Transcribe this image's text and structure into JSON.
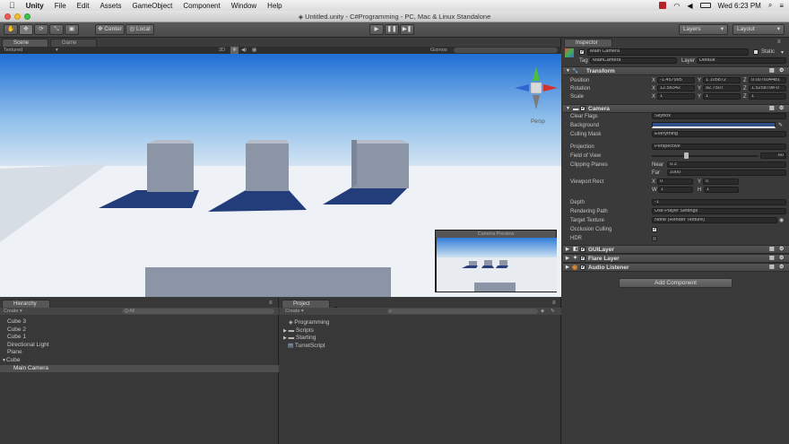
{
  "macmenu": {
    "apple": "",
    "items": [
      "Unity",
      "File",
      "Edit",
      "Assets",
      "GameObject",
      "Component",
      "Window",
      "Help"
    ],
    "clock": "Wed 6:23 PM"
  },
  "window": {
    "title": "Untitled.unity - C#Programming - PC, Mac & Linux Standalone"
  },
  "toolbar": {
    "center": "Center",
    "local": "Local",
    "layers": "Layers",
    "layout": "Layout"
  },
  "scene": {
    "tab_scene": "Scene",
    "tab_game": "Game",
    "shading": "Textured",
    "twod": "2D",
    "gizmos": "Gizmos",
    "persp": "Persp",
    "camera_preview": "Camera Preview"
  },
  "hierarchy": {
    "tab": "Hierarchy",
    "create": "Create",
    "search_placeholder": "Q-All",
    "items": [
      "Cube 3",
      "Cube 2",
      "Cube 1",
      "Directional Light",
      "Plane",
      "Cube",
      "Main Camera"
    ]
  },
  "project": {
    "tab": "Project",
    "create": "Create",
    "root": "Programming",
    "items": [
      "Scripts",
      "Starting",
      "TurretScript"
    ]
  },
  "inspector": {
    "tab": "Inspector",
    "object_name": "Main Camera",
    "static_label": "Static",
    "tag_label": "Tag",
    "tag_value": "MainCamera",
    "layer_label": "Layer",
    "layer_value": "Default",
    "transform": {
      "title": "Transform",
      "position_label": "Position",
      "rotation_label": "Rotation",
      "scale_label": "Scale",
      "position": [
        "-1.457995",
        "1.105872",
        "0.007694481"
      ],
      "rotation": [
        "12.58342",
        "92.7507",
        "1.525879e-0"
      ],
      "scale": [
        "1",
        "1",
        "1"
      ]
    },
    "camera": {
      "title": "Camera",
      "clear_flags_label": "Clear Flags",
      "clear_flags": "Skybox",
      "background_label": "Background",
      "culling_mask_label": "Culling Mask",
      "culling_mask": "Everything",
      "projection_label": "Projection",
      "projection": "Perspective",
      "fov_label": "Field of View",
      "fov": "60",
      "clipping_label": "Clipping Planes",
      "near_label": "Near",
      "near": "0.3",
      "far_label": "Far",
      "far": "1000",
      "viewport_label": "Viewport Rect",
      "vp_x": "0",
      "vp_y": "0",
      "vp_w": "1",
      "vp_h": "1",
      "depth_label": "Depth",
      "depth": "-1",
      "rendering_path_label": "Rendering Path",
      "rendering_path": "Use Player Settings",
      "target_texture_label": "Target Texture",
      "target_texture": "None (Render Texture)",
      "occlusion_label": "Occlusion Culling",
      "hdr_label": "HDR"
    },
    "gui_layer": "GUILayer",
    "flare_layer": "Flare Layer",
    "audio_listener": "Audio Listener",
    "add_component": "Add Component",
    "axis_x": "X",
    "axis_y": "Y",
    "axis_z": "Z",
    "axis_w": "W",
    "axis_h": "H"
  },
  "colors": {
    "accent_blue": "#3d6ecf",
    "sky_top": "#2f78d8",
    "ground": "#eef1f5"
  }
}
